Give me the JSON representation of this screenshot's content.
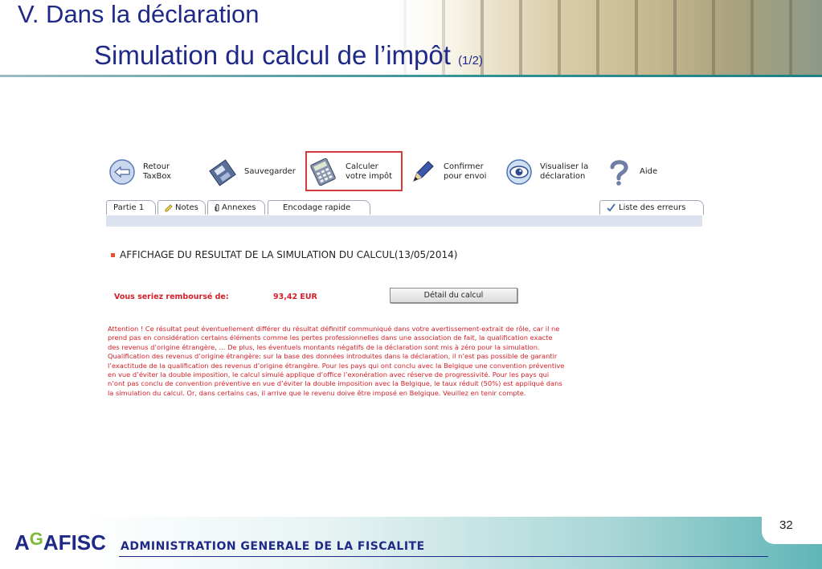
{
  "slide": {
    "title_line1": "V. Dans la déclaration",
    "title_line2": "Simulation du calcul de l’impôt",
    "title_page_fraction": "(1/2)",
    "page_number": "32"
  },
  "toolbar": {
    "items": [
      {
        "label": "Retour\nTaxBox",
        "icon": "back-arrow-icon"
      },
      {
        "label": "Sauvegarder",
        "icon": "save-disk-icon"
      },
      {
        "label": "Calculer\nvotre impôt",
        "icon": "calculator-icon",
        "highlighted": true
      },
      {
        "label": "Confirmer\npour envoi",
        "icon": "pen-icon"
      },
      {
        "label": "Visualiser la\ndéclaration",
        "icon": "eye-icon"
      },
      {
        "label": "Aide",
        "icon": "question-mark-icon"
      }
    ]
  },
  "tabs": {
    "partie": "Partie 1",
    "notes": "Notes",
    "annexes": "Annexes",
    "encodage": "Encodage rapide",
    "erreurs": "Liste des erreurs"
  },
  "result": {
    "section_title": "AFFICHAGE DU RESULTAT DE LA SIMULATION DU CALCUL(13/05/2014)",
    "label": "Vous seriez remboursé de:",
    "amount": "93,42 EUR",
    "detail_button": "Détail du calcul",
    "warning": "Attention ! Ce résultat peut éventuellement différer du résultat définitif communiqué dans votre avertissement-extrait de rôle, car il ne\nprend pas en considération certains éléments comme les pertes professionnelles dans une association de fait, la qualification exacte\ndes revenus d’origine étrangère, ... De plus, les éventuels montants négatifs de la déclaration sont mis à zéro pour la simulation.\nQualification des revenus d’origine étrangère: sur la base des données introduites dans la déclaration, il n’est pas possible de garantir\nl’exactitude de la qualification des revenus d’origine étrangère. Pour les pays qui ont conclu avec la Belgique une convention préventive\nen vue d’éviter la double imposition, le calcul simulé applique d’office l’exonération avec réserve de progressivité. Pour les pays qui\nn’ont pas conclu de convention préventive en vue d’éviter la double imposition avec la Belgique, le taux réduit (50%) est appliqué dans\nla simulation du calcul. Or, dans certains cas, il arrive que le revenu doive être imposé en Belgique. Veuillez en tenir compte."
  },
  "footer": {
    "logo_a": "A",
    "logo_g": "G",
    "logo_rest": "AFISC",
    "admin_text": "ADMINISTRATION GENERALE DE LA FISCALITE"
  },
  "colors": {
    "title": "#1f2a88",
    "warning": "#d3212a",
    "highlight_box": "#d63a3a",
    "teal": "#2f8f93"
  }
}
